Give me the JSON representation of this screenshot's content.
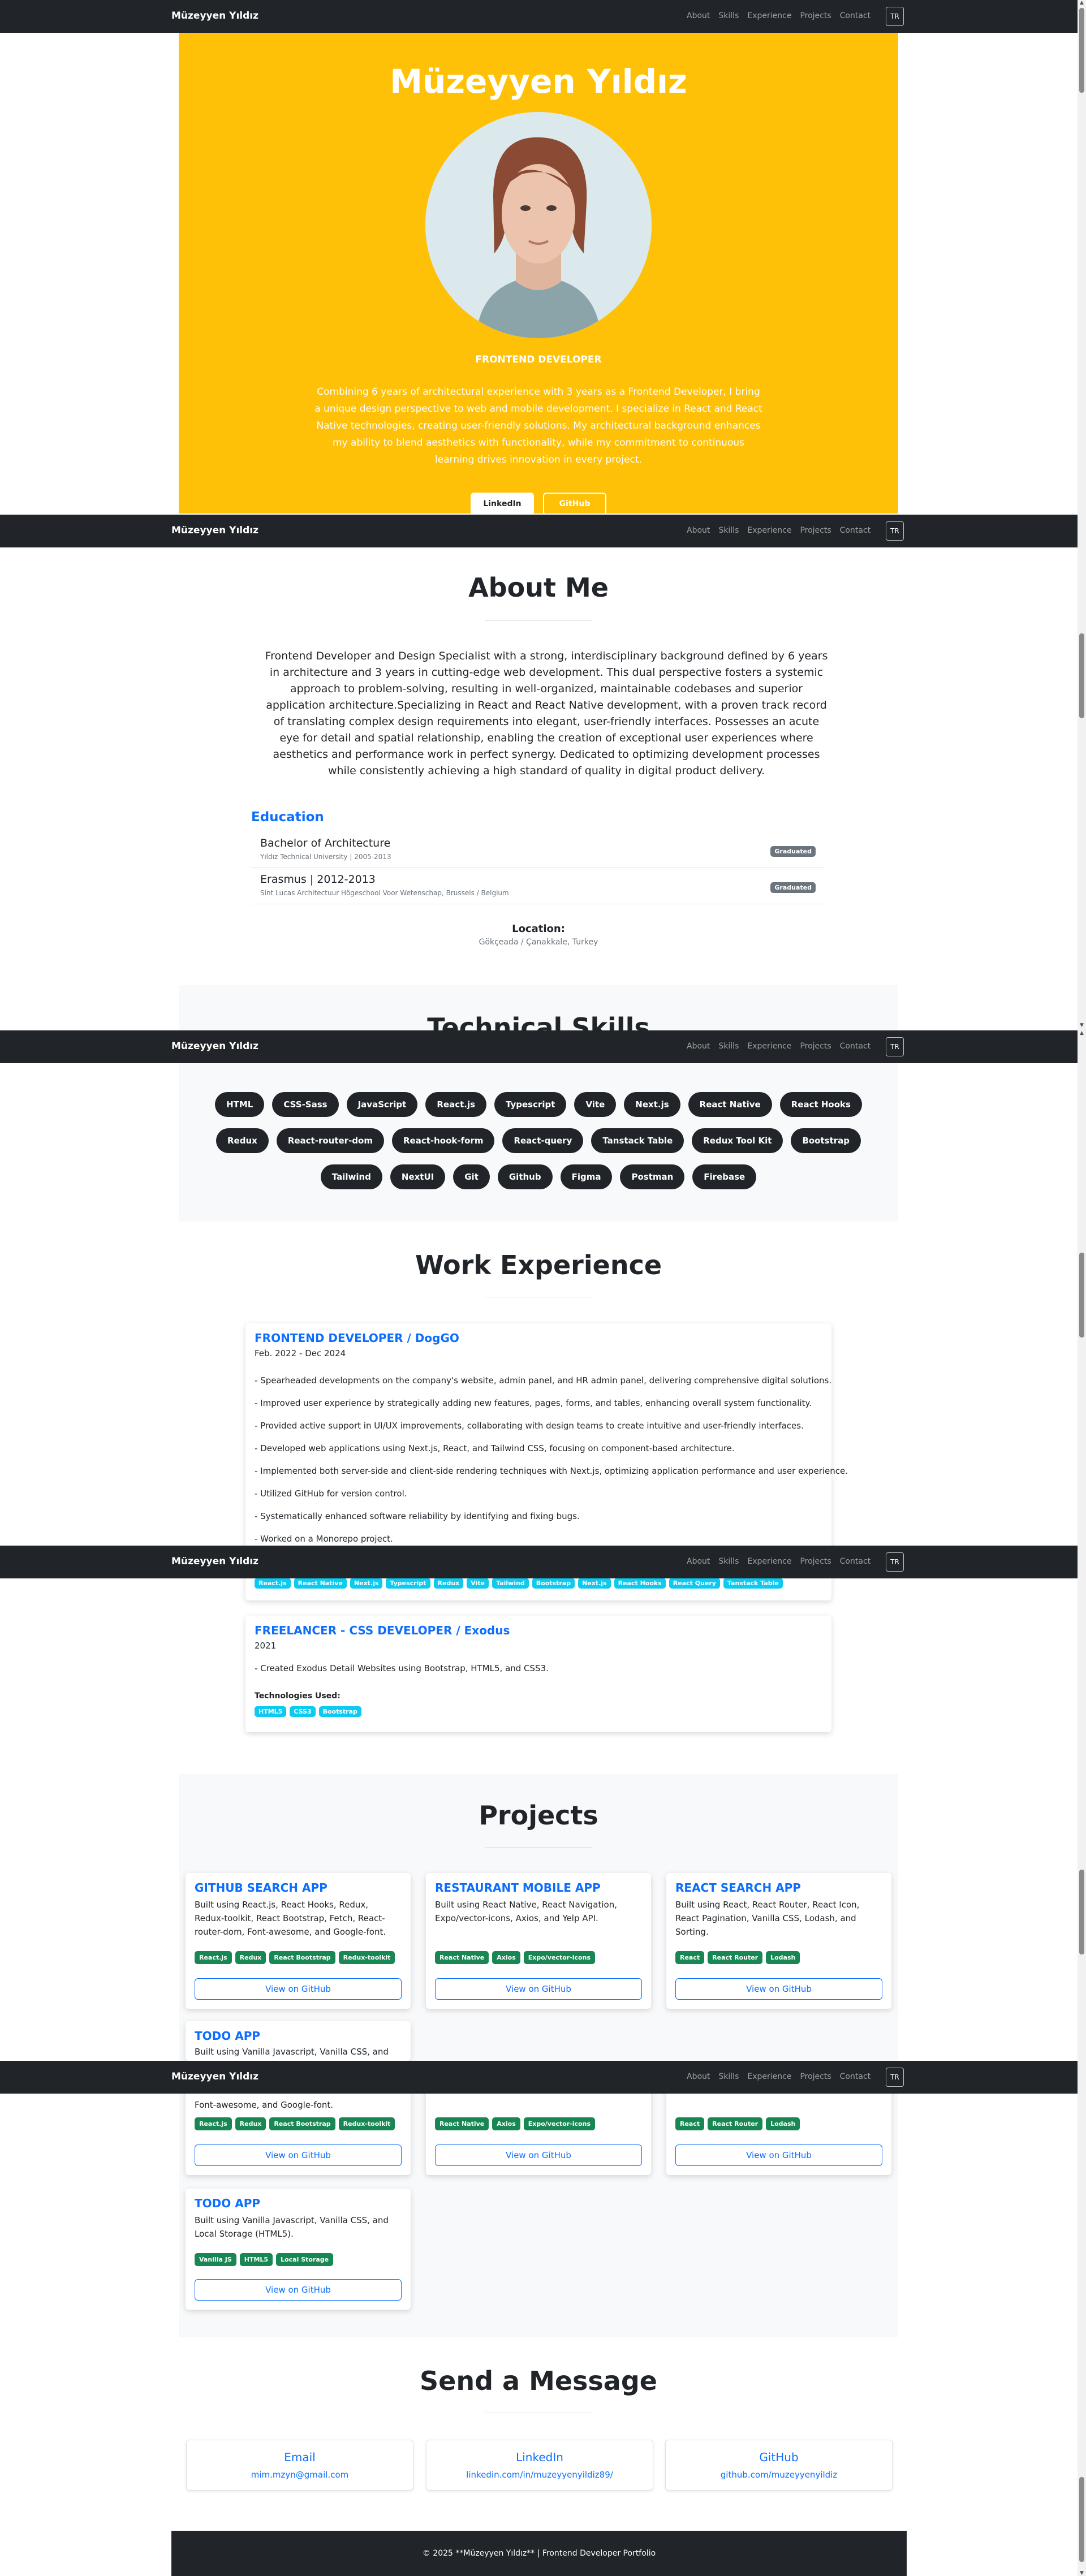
{
  "nav": {
    "brand": "Müzeyyen Yıldız",
    "links": [
      "About",
      "Skills",
      "Experience",
      "Projects",
      "Contact"
    ],
    "lang": "TR"
  },
  "hero": {
    "name": "Müzeyyen Yıldız",
    "role": "FRONTEND DEVELOPER",
    "bio": "Combining 6 years of architectural experience with 3 years as a Frontend Developer, I bring a unique design perspective to web and mobile development. I specialize in React and React Native technologies, creating user-friendly solutions. My architectural background enhances my ability to blend aesthetics with functionality, while my commitment to continuous learning drives innovation in every project.",
    "buttons": [
      "LinkedIn",
      "GitHub"
    ]
  },
  "about": {
    "title": "About Me",
    "text": "Frontend Developer and Design Specialist with a strong, interdisciplinary background defined by 6 years in architecture and 3 years in cutting-edge web development. This dual perspective fosters a systemic approach to problem-solving, resulting in well-organized, maintainable codebases and superior application architecture.Specializing in React and React Native development, with a proven track record of translating complex design requirements into elegant, user-friendly interfaces. Possesses an acute eye for detail and spatial relationship, enabling the creation of exceptional user experiences where aesthetics and performance work in perfect synergy. Dedicated to optimizing development processes while consistently achieving a high standard of quality in digital product delivery.",
    "education_title": "Education",
    "education": [
      {
        "name": "Bachelor of Architecture",
        "sub": "Yıldız Technical University | 2005-2013",
        "badge": "Graduated"
      },
      {
        "name": "Erasmus | 2012-2013",
        "sub": "Sint Lucas Architectuur Högeschool Voor Wetenschap, Brussels / Belgium",
        "badge": "Graduated"
      }
    ],
    "location_title": "Location:",
    "location": "Gökçeada / Çanakkale, Turkey"
  },
  "skills": {
    "title": "Technical Skills",
    "row1": [
      "HTML",
      "CSS-Sass",
      "JavaScript",
      "React.js",
      "Typescript",
      "Vite",
      "Next.js",
      "React Native",
      "React Hooks"
    ],
    "row2": [
      "Redux",
      "React-router-dom",
      "React-hook-form",
      "React-query",
      "Tanstack Table",
      "Redux Tool Kit",
      "Bootstrap"
    ],
    "row3": [
      "Tailwind",
      "NextUI",
      "Git",
      "Github",
      "Figma",
      "Postman",
      "Firebase"
    ]
  },
  "experience": {
    "title": "Work Experience",
    "jobs": [
      {
        "title": "FRONTEND DEVELOPER / DogGO",
        "date": "Feb. 2022 - Dec 2024",
        "bullets": [
          "- Spearheaded developments on the company's website, admin panel, and HR admin panel, delivering comprehensive digital solutions.",
          "- Improved user experience by strategically adding new features, pages, forms, and tables, enhancing overall system functionality.",
          "- Provided active support in UI/UX improvements, collaborating with design teams to create intuitive and user-friendly interfaces.",
          "- Developed web applications using Next.js, React, and Tailwind CSS, focusing on component-based architecture.",
          "- Implemented both server-side and client-side rendering techniques with Next.js, optimizing application performance and user experience.",
          "- Utilized GitHub for version control.",
          "- Systematically enhanced software reliability by identifying and fixing bugs.",
          "- Worked on a Monorepo project."
        ],
        "tags": [
          "React.js",
          "React Native",
          "Next.js",
          "Typescript",
          "Redux",
          "Vite",
          "Tailwind",
          "Bootstrap",
          "Next.js",
          "React Hooks",
          "React Query",
          "Tanstack Table"
        ]
      },
      {
        "title": "FREELANCER - CSS DEVELOPER / Exodus",
        "date": "2021",
        "bullets": [
          "- Created Exodus Detail Websites using Bootstrap, HTML5, and CSS3."
        ],
        "tech_label": "Technologies Used:",
        "tags": [
          "HTML5",
          "CSS3",
          "Bootstrap"
        ]
      }
    ]
  },
  "projects": {
    "title": "Projects",
    "button": "View on GitHub",
    "items": [
      {
        "title": "GITHUB SEARCH APP",
        "desc": "Built using React.js, React Hooks, Redux, Redux-toolkit, React Bootstrap, Fetch, React-router-dom, Font-awesome, and Google-font.",
        "tags": [
          "React.js",
          "Redux",
          "React Bootstrap",
          "Redux-toolkit"
        ]
      },
      {
        "title": "RESTAURANT MOBILE APP",
        "desc": "Built using React Native, React Navigation, Expo/vector-icons, Axios, and Yelp API.",
        "tags": [
          "React Native",
          "Axios",
          "Expo/vector-icons"
        ]
      },
      {
        "title": "REACT SEARCH APP",
        "desc": "Built using React, React Router, React Icon, React Pagination, Vanilla CSS, Lodash, and Sorting.",
        "tags": [
          "React",
          "React Router",
          "Lodash"
        ]
      },
      {
        "title": "TODO APP",
        "desc": "Built using Vanilla Javascript, Vanilla CSS, and Local Storage (HTML5).",
        "tags": [
          "Vanilla JS",
          "HTML5",
          "Local Storage"
        ]
      }
    ],
    "overlap_desc_partial": "Font-awesome, and Google-font.",
    "todo_partial": "Built using Vanilla Javascript, Vanilla CSS, and Local"
  },
  "contact": {
    "title": "Send a Message",
    "items": [
      {
        "label": "Email",
        "value": "mim.mzyn@gmail.com"
      },
      {
        "label": "LinkedIn",
        "value": "linkedin.com/in/muzeyyenyildiz89/"
      },
      {
        "label": "GitHub",
        "value": "github.com/muzeyyenyildiz"
      }
    ]
  },
  "footer": "© 2025 **Müzeyyen Yıldız** | Frontend Developer Portfolio"
}
